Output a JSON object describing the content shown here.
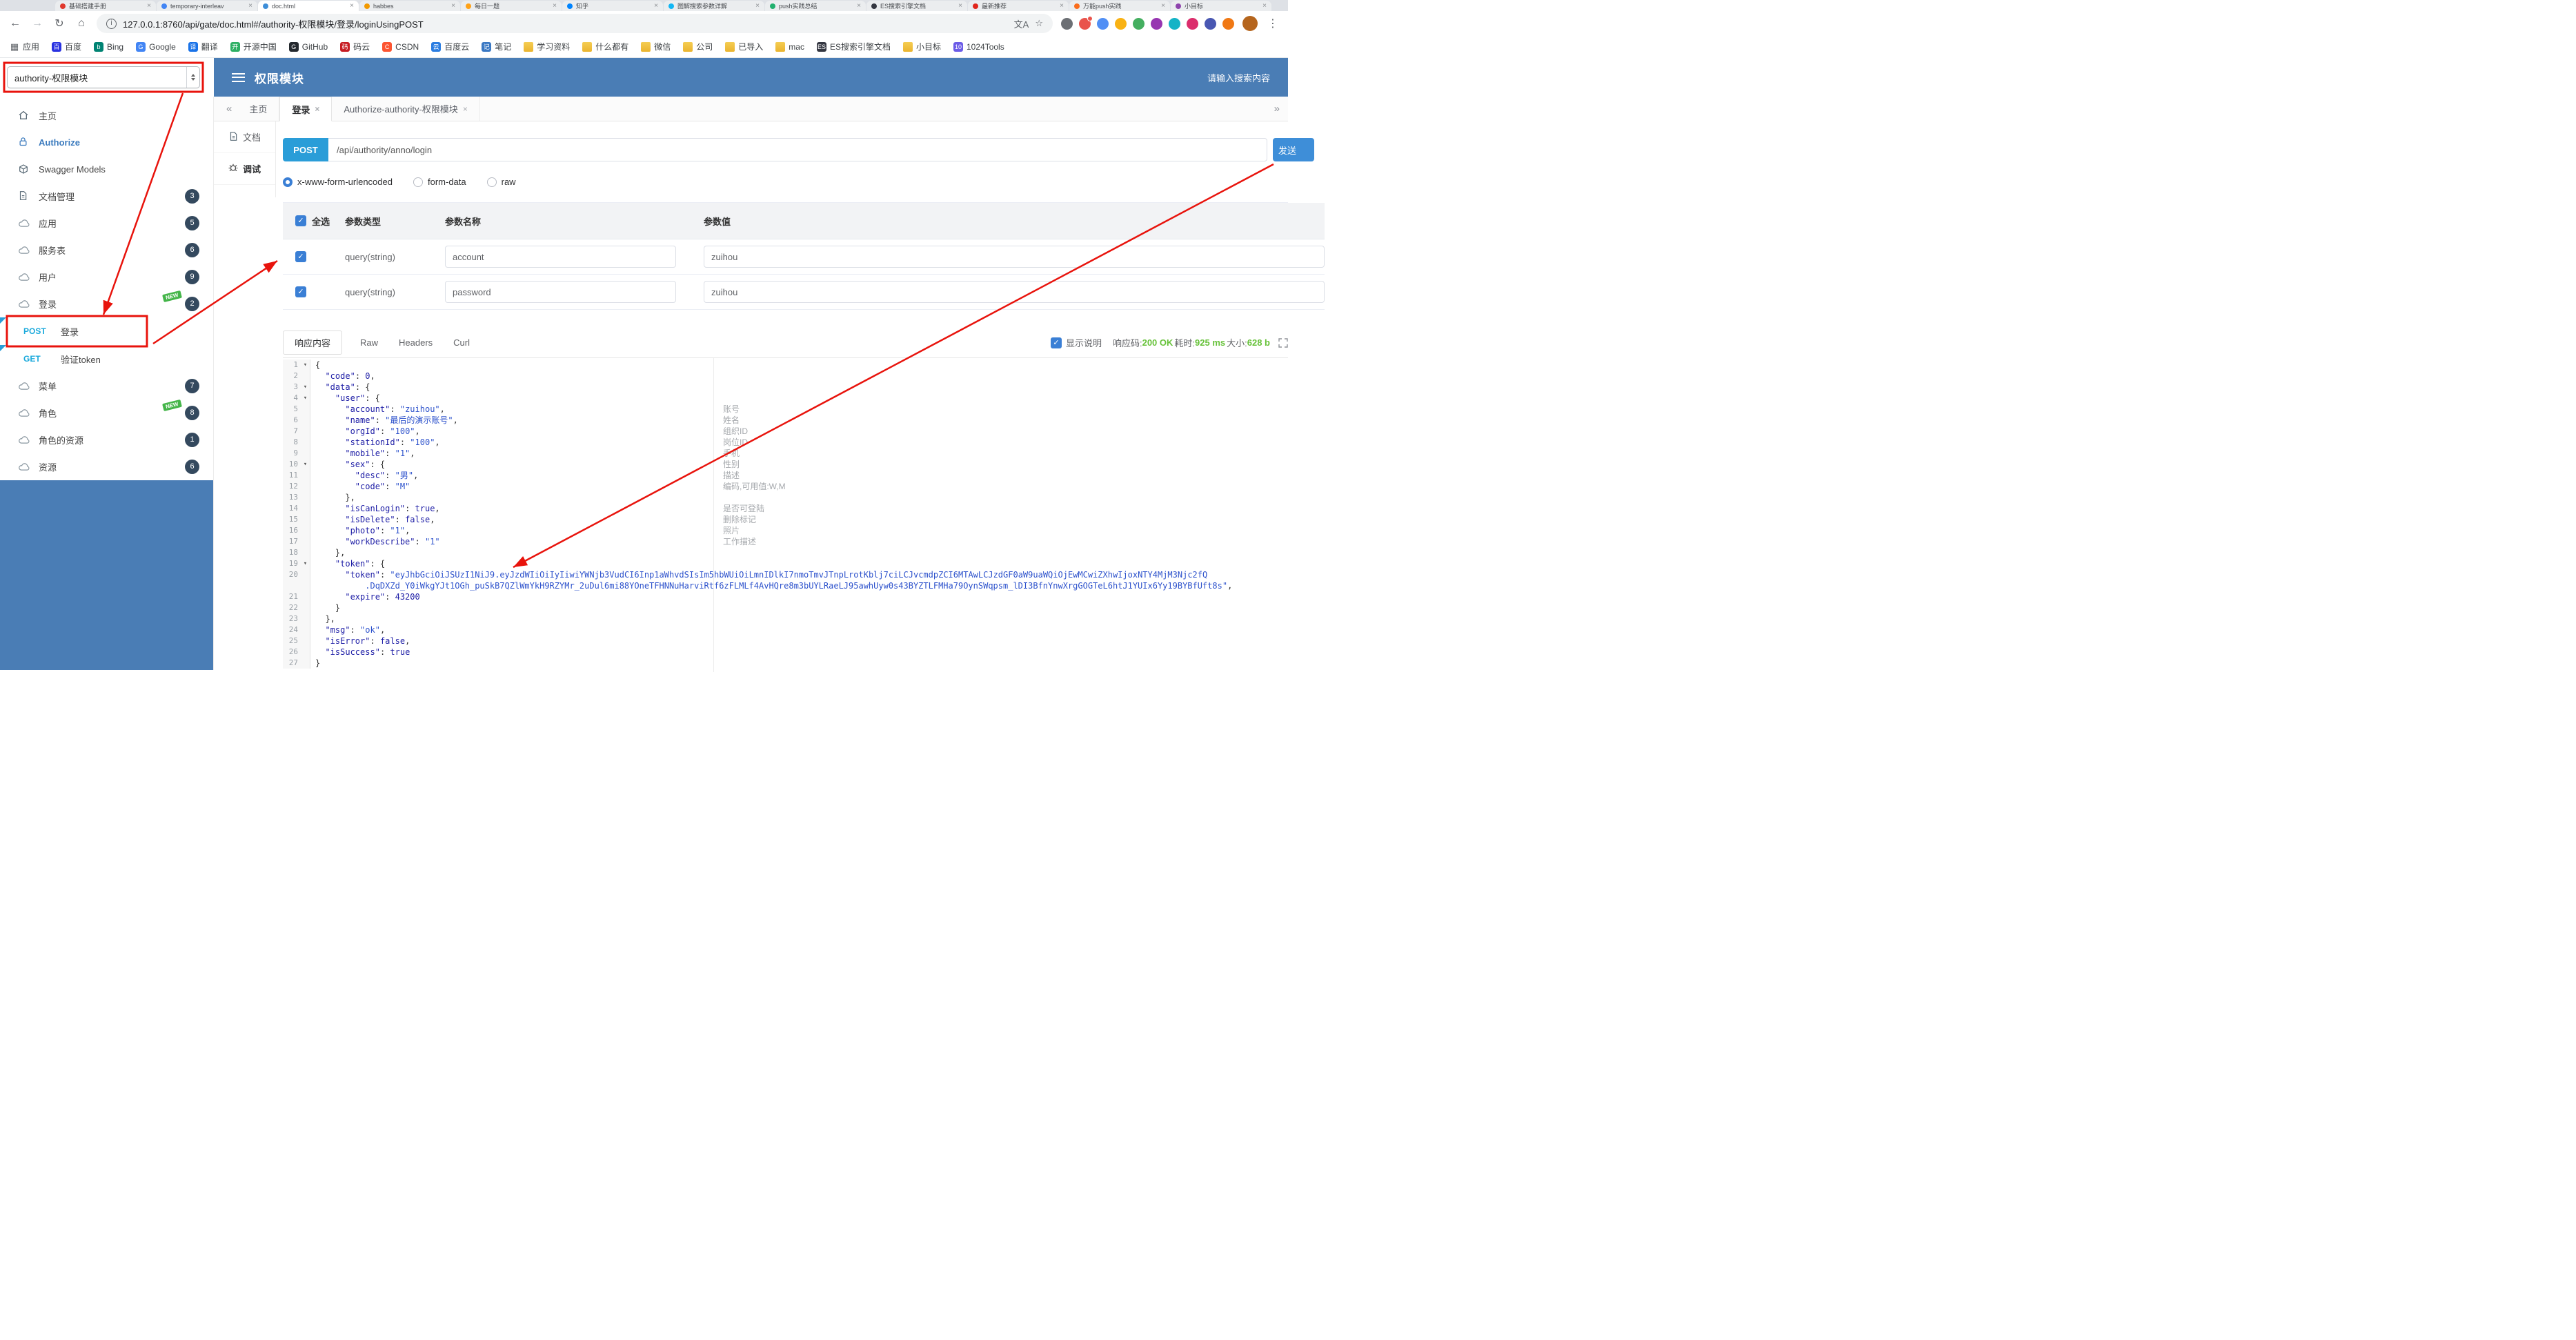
{
  "icons": {
    "back": "←",
    "forward": "→",
    "reload": "↻",
    "home": "⌂",
    "info": "i",
    "translate": "文A",
    "star": "☆",
    "more": "⋮",
    "collapse": "«",
    "expand": "»",
    "close": "×",
    "caret": "▾",
    "check": "✓",
    "apps": "▦"
  },
  "browser": {
    "url": "127.0.0.1:8760/api/gate/doc.html#/authority-权限模块/登录/loginUsingPOST",
    "active_tab": 2,
    "tabs": [
      {
        "title": "基础搭建手册",
        "color": "#e0382d"
      },
      {
        "title": "temporary-interleav",
        "color": "#4285f4"
      },
      {
        "title": "doc.html",
        "color": "#3e8ed8"
      },
      {
        "title": "habbes",
        "color": "#f29900"
      },
      {
        "title": "每日一题",
        "color": "#ffa116"
      },
      {
        "title": "知乎",
        "color": "#0084ff"
      },
      {
        "title": "图解搜索参数详解",
        "color": "#12b7f5"
      },
      {
        "title": "push实践总结",
        "color": "#21b06e"
      },
      {
        "title": "ES搜索引擎文档",
        "color": "#343741"
      },
      {
        "title": "最新推荐",
        "color": "#e1251b"
      },
      {
        "title": "万能push实践",
        "color": "#fa6d1d"
      },
      {
        "title": "小目标",
        "color": "#8e44ad"
      }
    ],
    "extensions": [
      "#5f6368",
      "#e8453c",
      "#4285f4",
      "#f9ab00",
      "#34a853",
      "#8e24aa",
      "#00acc1",
      "#d81b60",
      "#3949ab",
      "#ef6c00"
    ],
    "badge_ext": 1,
    "bookmarks": [
      {
        "label": "应用",
        "ic": "",
        "c": "apps"
      },
      {
        "label": "百度",
        "ic": "百",
        "c": "#2932e1"
      },
      {
        "label": "Bing",
        "ic": "b",
        "c": "#008373"
      },
      {
        "label": "Google",
        "ic": "G",
        "c": "#4285f4"
      },
      {
        "label": "翻译",
        "ic": "译",
        "c": "#1a73e8"
      },
      {
        "label": "开源中国",
        "ic": "开",
        "c": "#2daf63"
      },
      {
        "label": "GitHub",
        "ic": "G",
        "c": "#24292e"
      },
      {
        "label": "码云",
        "ic": "码",
        "c": "#c71d23"
      },
      {
        "label": "CSDN",
        "ic": "C",
        "c": "#fc5531"
      },
      {
        "label": "百度云",
        "ic": "云",
        "c": "#2b7de1"
      },
      {
        "label": "笔记",
        "ic": "记",
        "c": "#3a78c3"
      },
      {
        "label": "学习资料",
        "ic": "",
        "c": "folder"
      },
      {
        "label": "什么都有",
        "ic": "",
        "c": "folder"
      },
      {
        "label": "微信",
        "ic": "",
        "c": "folder"
      },
      {
        "label": "公司",
        "ic": "",
        "c": "folder"
      },
      {
        "label": "已导入",
        "ic": "",
        "c": "folder"
      },
      {
        "label": "mac",
        "ic": "",
        "c": "folder"
      },
      {
        "label": "ES搜索引擎文档",
        "ic": "ES",
        "c": "#343741"
      },
      {
        "label": "小目标",
        "ic": "",
        "c": "folder"
      },
      {
        "label": "1024Tools",
        "ic": "10",
        "c": "#6c5ce7"
      }
    ]
  },
  "header": {
    "project_select": "authority-权限模块",
    "title": "权限模块",
    "search_placeholder": "请输入搜索内容"
  },
  "sidebar": {
    "new_label": "NEW",
    "items": [
      {
        "label": "主页",
        "icon": "home"
      },
      {
        "label": "Authorize",
        "icon": "lock",
        "accent": true
      },
      {
        "label": "Swagger Models",
        "icon": "models"
      },
      {
        "label": "文档管理",
        "icon": "doc",
        "badge": "3"
      },
      {
        "label": "应用",
        "icon": "cloud",
        "badge": "5"
      },
      {
        "label": "服务表",
        "icon": "cloud",
        "badge": "6"
      },
      {
        "label": "用户",
        "icon": "cloud",
        "badge": "9"
      },
      {
        "label": "登录",
        "icon": "cloud",
        "badge": "2",
        "is_new": true
      },
      {
        "method": "POST",
        "label": "登录",
        "highlighted": true
      },
      {
        "method": "GET",
        "label": "验证token"
      },
      {
        "label": "菜单",
        "icon": "cloud",
        "badge": "7"
      },
      {
        "label": "角色",
        "icon": "cloud",
        "badge": "8",
        "is_new": true
      },
      {
        "label": "角色的资源",
        "icon": "cloud",
        "badge": "1"
      },
      {
        "label": "资源",
        "icon": "cloud",
        "badge": "6"
      }
    ]
  },
  "main_tabs": {
    "items": [
      {
        "label": "主页"
      },
      {
        "label": "登录",
        "closable": true,
        "active": true
      },
      {
        "label": "Authorize-authority-权限模块",
        "closable": true
      }
    ]
  },
  "doc_tabs": {
    "items": [
      {
        "label": "文档",
        "icon": "doc"
      },
      {
        "label": "调试",
        "icon": "debug",
        "active": true
      }
    ]
  },
  "request": {
    "method": "POST",
    "url": "/api/authority/anno/login",
    "send_label": "发送",
    "content_types": [
      {
        "label": "x-www-form-urlencoded",
        "selected": true
      },
      {
        "label": "form-data"
      },
      {
        "label": "raw"
      }
    ]
  },
  "params": {
    "headers": {
      "all": "全选",
      "type": "参数类型",
      "name": "参数名称",
      "value": "参数值"
    },
    "rows": [
      {
        "checked": true,
        "type": "query(string)",
        "name": "account",
        "value": "zuihou"
      },
      {
        "checked": true,
        "type": "query(string)",
        "name": "password",
        "value": "zuihou"
      }
    ]
  },
  "response": {
    "tabs": [
      {
        "label": "响应内容",
        "active": true
      },
      {
        "label": "Raw"
      },
      {
        "label": "Headers"
      },
      {
        "label": "Curl"
      }
    ],
    "show_desc_label": "显示说明",
    "meta": [
      {
        "label": "响应码:",
        "value": "200 OK"
      },
      {
        "label": "耗时:",
        "value": "925 ms"
      },
      {
        "label": "大小:",
        "value": "628 b"
      }
    ]
  },
  "editor": {
    "lines": [
      {
        "n": 1,
        "fold": true,
        "tok": [
          [
            "p",
            "{"
          ]
        ]
      },
      {
        "n": 2,
        "tok": [
          [
            "p",
            "  "
          ],
          [
            "k",
            "\"code\""
          ],
          [
            "p",
            ": "
          ],
          [
            "n",
            "0"
          ],
          [
            "p",
            ","
          ]
        ]
      },
      {
        "n": 3,
        "fold": true,
        "tok": [
          [
            "p",
            "  "
          ],
          [
            "k",
            "\"data\""
          ],
          [
            "p",
            ": {"
          ]
        ]
      },
      {
        "n": 4,
        "fold": true,
        "tok": [
          [
            "p",
            "    "
          ],
          [
            "k",
            "\"user\""
          ],
          [
            "p",
            ": {"
          ]
        ]
      },
      {
        "n": 5,
        "note": "账号",
        "tok": [
          [
            "p",
            "      "
          ],
          [
            "k",
            "\"account\""
          ],
          [
            "p",
            ": "
          ],
          [
            "s",
            "\"zuihou\""
          ],
          [
            "p",
            ","
          ]
        ]
      },
      {
        "n": 6,
        "note": "姓名",
        "tok": [
          [
            "p",
            "      "
          ],
          [
            "k",
            "\"name\""
          ],
          [
            "p",
            ": "
          ],
          [
            "s",
            "\"最后的演示账号\""
          ],
          [
            "p",
            ","
          ]
        ]
      },
      {
        "n": 7,
        "note": "组织ID",
        "tok": [
          [
            "p",
            "      "
          ],
          [
            "k",
            "\"orgId\""
          ],
          [
            "p",
            ": "
          ],
          [
            "s",
            "\"100\""
          ],
          [
            "p",
            ","
          ]
        ]
      },
      {
        "n": 8,
        "note": "岗位ID",
        "tok": [
          [
            "p",
            "      "
          ],
          [
            "k",
            "\"stationId\""
          ],
          [
            "p",
            ": "
          ],
          [
            "s",
            "\"100\""
          ],
          [
            "p",
            ","
          ]
        ]
      },
      {
        "n": 9,
        "note": "手机",
        "tok": [
          [
            "p",
            "      "
          ],
          [
            "k",
            "\"mobile\""
          ],
          [
            "p",
            ": "
          ],
          [
            "s",
            "\"1\""
          ],
          [
            "p",
            ","
          ]
        ]
      },
      {
        "n": 10,
        "fold": true,
        "note": "性别",
        "tok": [
          [
            "p",
            "      "
          ],
          [
            "k",
            "\"sex\""
          ],
          [
            "p",
            ": {"
          ]
        ]
      },
      {
        "n": 11,
        "note": "描述",
        "tok": [
          [
            "p",
            "        "
          ],
          [
            "k",
            "\"desc\""
          ],
          [
            "p",
            ": "
          ],
          [
            "s",
            "\"男\""
          ],
          [
            "p",
            ","
          ]
        ]
      },
      {
        "n": 12,
        "note": "编码,可用值:W,M",
        "tok": [
          [
            "p",
            "        "
          ],
          [
            "k",
            "\"code\""
          ],
          [
            "p",
            ": "
          ],
          [
            "s",
            "\"M\""
          ]
        ]
      },
      {
        "n": 13,
        "tok": [
          [
            "p",
            "      },"
          ]
        ]
      },
      {
        "n": 14,
        "note": "是否可登陆",
        "tok": [
          [
            "p",
            "      "
          ],
          [
            "k",
            "\"isCanLogin\""
          ],
          [
            "p",
            ": "
          ],
          [
            "b",
            "true"
          ],
          [
            "p",
            ","
          ]
        ]
      },
      {
        "n": 15,
        "note": "删除标记",
        "tok": [
          [
            "p",
            "      "
          ],
          [
            "k",
            "\"isDelete\""
          ],
          [
            "p",
            ": "
          ],
          [
            "b",
            "false"
          ],
          [
            "p",
            ","
          ]
        ]
      },
      {
        "n": 16,
        "note": "照片",
        "tok": [
          [
            "p",
            "      "
          ],
          [
            "k",
            "\"photo\""
          ],
          [
            "p",
            ": "
          ],
          [
            "s",
            "\"1\""
          ],
          [
            "p",
            ","
          ]
        ]
      },
      {
        "n": 17,
        "note": "工作描述",
        "tok": [
          [
            "p",
            "      "
          ],
          [
            "k",
            "\"workDescribe\""
          ],
          [
            "p",
            ": "
          ],
          [
            "s",
            "\"1\""
          ]
        ]
      },
      {
        "n": 18,
        "tok": [
          [
            "p",
            "    },"
          ]
        ]
      },
      {
        "n": 19,
        "fold": true,
        "tok": [
          [
            "p",
            "    "
          ],
          [
            "k",
            "\"token\""
          ],
          [
            "p",
            ": {"
          ]
        ]
      },
      {
        "n": 20,
        "tok": [
          [
            "p",
            "      "
          ],
          [
            "k",
            "\"token\""
          ],
          [
            "p",
            ": "
          ],
          [
            "s",
            "\"eyJhbGciOiJSUzI1NiJ9.eyJzdWIiOiIyIiwiYWNjb3VudCI6Inp1aWhvdSIsIm5hbWUiOiLmnIDlkI7nmoTmvJTnpLrotKblj7ciLCJvcmdpZCI6MTAwLCJzdGF0aW9uaWQiOjEwMCwiZXhwIjoxNTY4MjM3Njc2fQ\n          .DqDXZd_Y0iWkgYJt1OGh_puSkB7QZlWmYkH9RZYMr_2uDul6mi88YOneTFHNNuHarviRtf6zFLMLf4AvHQre8m3bUYLRaeLJ95awhUyw0s43BYZTLFMHa79OynSWqpsm_lDI3BfnYnwXrgGOGTeL6htJ1YUIx6Yy19BYBfUft8s\""
          ],
          [
            "p",
            ","
          ]
        ]
      },
      {
        "n": 21,
        "tok": [
          [
            "p",
            "      "
          ],
          [
            "k",
            "\"expire\""
          ],
          [
            "p",
            ": "
          ],
          [
            "n",
            "43200"
          ]
        ]
      },
      {
        "n": 22,
        "tok": [
          [
            "p",
            "    }"
          ]
        ]
      },
      {
        "n": 23,
        "tok": [
          [
            "p",
            "  },"
          ]
        ]
      },
      {
        "n": 24,
        "tok": [
          [
            "p",
            "  "
          ],
          [
            "k",
            "\"msg\""
          ],
          [
            "p",
            ": "
          ],
          [
            "s",
            "\"ok\""
          ],
          [
            "p",
            ","
          ]
        ]
      },
      {
        "n": 25,
        "tok": [
          [
            "p",
            "  "
          ],
          [
            "k",
            "\"isError\""
          ],
          [
            "p",
            ": "
          ],
          [
            "b",
            "false"
          ],
          [
            "p",
            ","
          ]
        ]
      },
      {
        "n": 26,
        "tok": [
          [
            "p",
            "  "
          ],
          [
            "k",
            "\"isSuccess\""
          ],
          [
            "p",
            ": "
          ],
          [
            "b",
            "true"
          ]
        ]
      },
      {
        "n": 27,
        "tok": [
          [
            "p",
            "}"
          ]
        ]
      }
    ]
  }
}
